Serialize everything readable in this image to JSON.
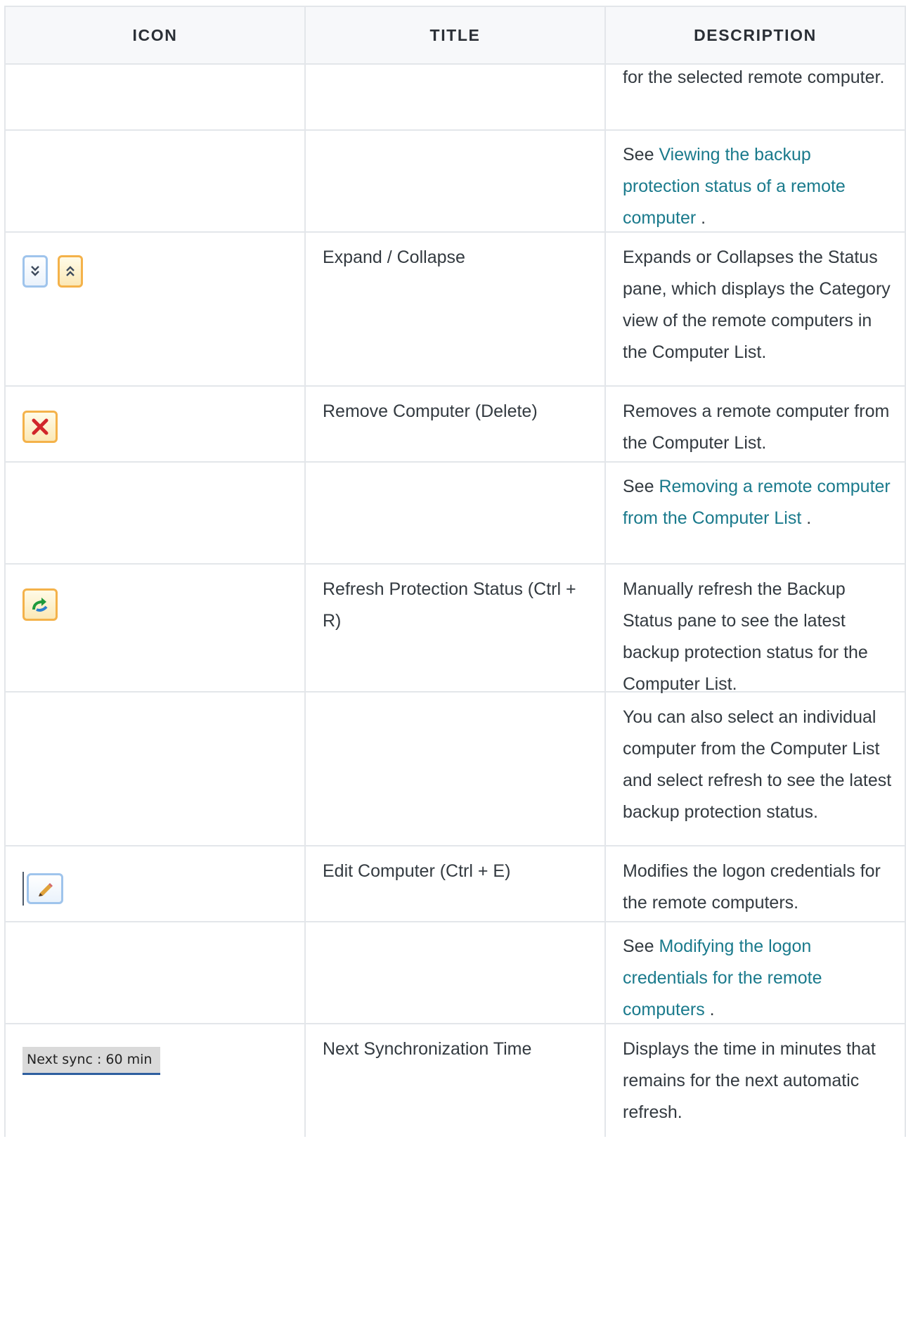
{
  "table": {
    "headers": {
      "icon": "ICON",
      "title": "TITLE",
      "description": "DESCRIPTION"
    },
    "rows": [
      {
        "title": "",
        "desc": "for the selected remote computer."
      },
      {
        "title": "",
        "see_prefix": "See ",
        "link": "Viewing the backup protection status of a remote computer",
        "see_suffix": " ."
      },
      {
        "icon": "expand-collapse-icons",
        "title": "Expand / Collapse",
        "desc": "Expands or Collapses the Status pane, which displays the Category view of the remote computers in the Computer List."
      },
      {
        "icon": "remove-computer-icon",
        "title": "Remove Computer (Delete)",
        "desc": "Removes a remote computer from the Computer List."
      },
      {
        "title": "",
        "see_prefix": "See ",
        "link": "Removing a remote computer from the Computer List",
        "see_suffix": " ."
      },
      {
        "icon": "refresh-icon",
        "title": "Refresh Protection Status (Ctrl + R)",
        "desc": "Manually refresh the Backup Status pane to see the latest backup protection status for the Computer List."
      },
      {
        "title": "",
        "desc": "You can also select an individual computer from the Computer List and select refresh to see the latest backup protection status."
      },
      {
        "icon": "edit-computer-icon",
        "title": "Edit Computer (Ctrl + E)",
        "desc": "Modifies the logon credentials for the remote computers."
      },
      {
        "title": "",
        "see_prefix": "See ",
        "link": "Modifying the logon credentials for the remote computers",
        "see_suffix": " ."
      },
      {
        "icon": "next-sync-indicator",
        "icon_text": "Next sync : 60 min",
        "title": "Next Synchronization Time",
        "desc": "Displays the time in minutes that remains for the next automatic refresh."
      }
    ]
  },
  "colors": {
    "link": "#1a7a8c",
    "border": "#e3e6ea",
    "text": "#333a40",
    "header_bg": "#f7f8fa"
  }
}
